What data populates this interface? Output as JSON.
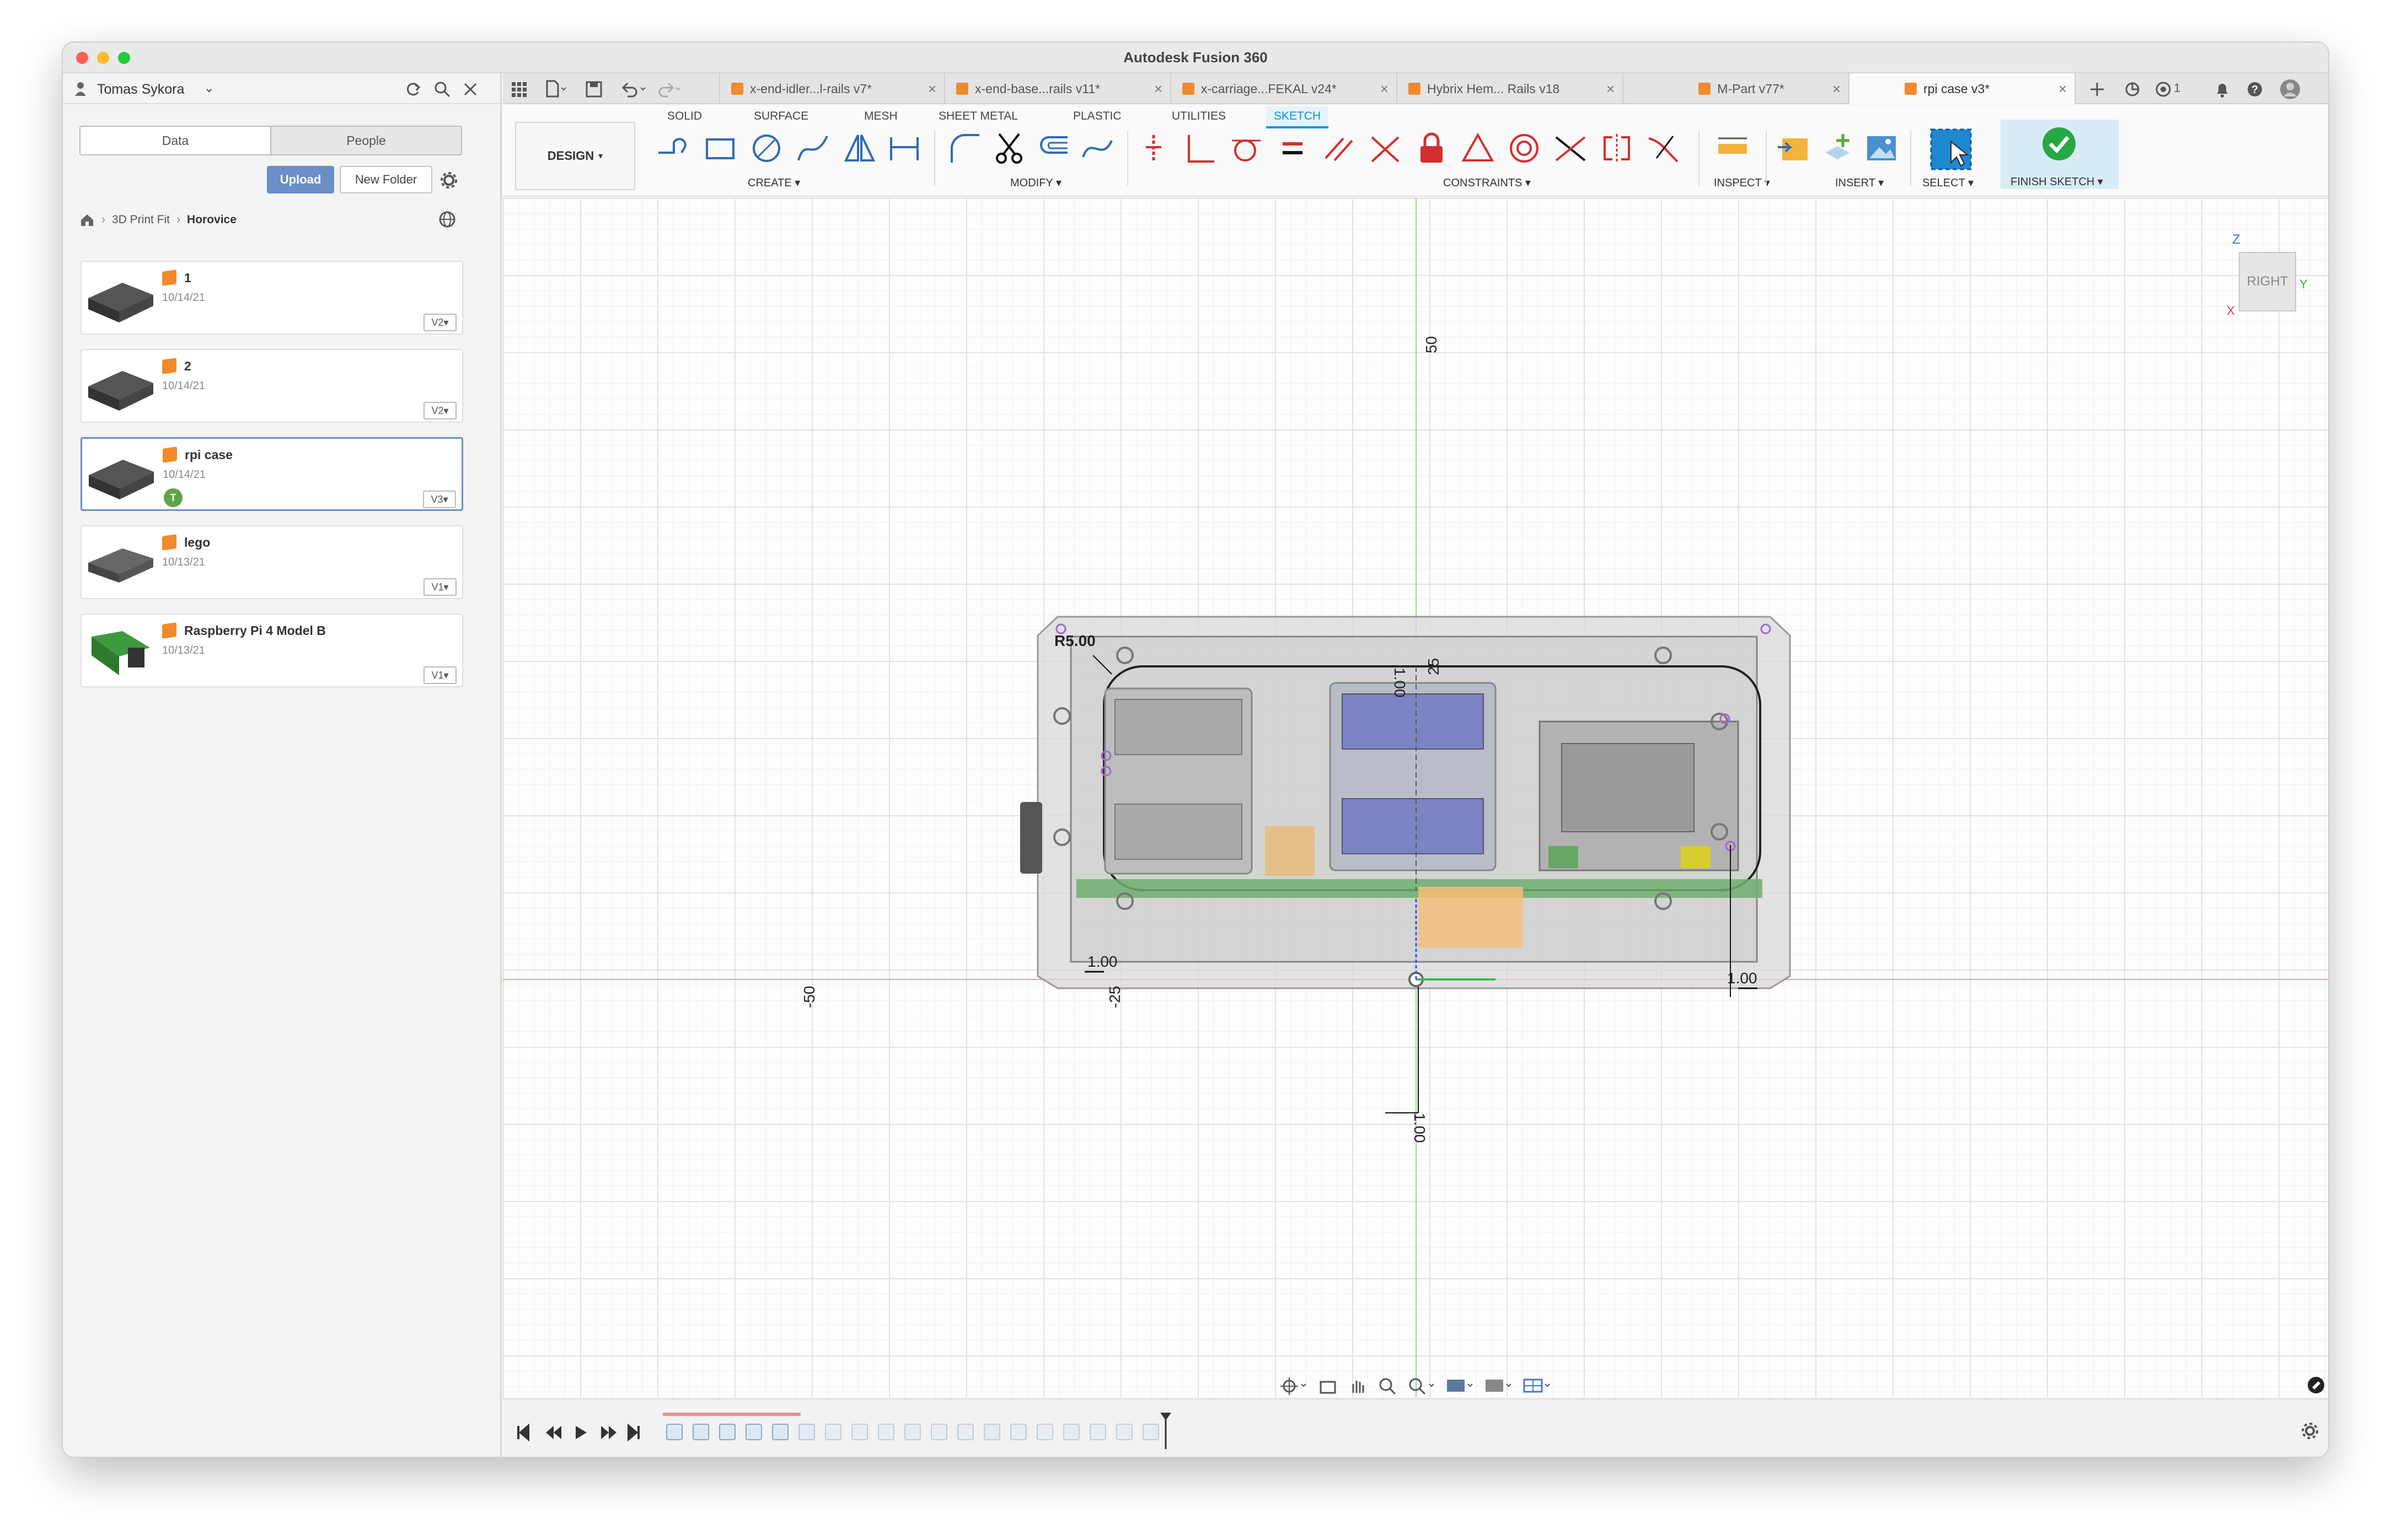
{
  "window": {
    "title": "Autodesk Fusion 360"
  },
  "data_panel": {
    "user": "Tomas Sykora",
    "user_icon": "person-icon",
    "toggle": [
      "Data",
      "People"
    ],
    "upload": "Upload",
    "new_folder": "New Folder",
    "breadcrumb": [
      "3D Print Fit",
      "Horovice"
    ],
    "items": [
      {
        "name": "1",
        "date": "10/14/21",
        "version": "V2"
      },
      {
        "name": "2",
        "date": "10/14/21",
        "version": "V2"
      },
      {
        "name": "rpi case",
        "date": "10/14/21",
        "version": "V3",
        "selected": true
      },
      {
        "name": "lego",
        "date": "10/13/21",
        "version": "V1"
      },
      {
        "name": "Raspberry Pi 4 Model B",
        "date": "10/13/21",
        "version": "V1"
      }
    ]
  },
  "tabs": [
    {
      "label": "x-end-idler...l-rails v7*",
      "active": false
    },
    {
      "label": "x-end-base...rails v11*",
      "active": false
    },
    {
      "label": "x-carriage...FEKAL v24*",
      "active": false
    },
    {
      "label": "Hybrix Hem... Rails v18",
      "active": false
    },
    {
      "label": "M-Part v77*",
      "active": false
    },
    {
      "label": "rpi case v3*",
      "active": true
    }
  ],
  "tabbar_right": {
    "jobs_count": "1"
  },
  "ribbon": {
    "workspace": "DESIGN",
    "tabs": [
      "SOLID",
      "SURFACE",
      "MESH",
      "SHEET METAL",
      "PLASTIC",
      "UTILITIES",
      "SKETCH"
    ],
    "active_tab": "SKETCH",
    "groups": [
      "CREATE",
      "MODIFY",
      "CONSTRAINTS",
      "INSPECT",
      "INSERT",
      "SELECT",
      "FINISH SKETCH"
    ]
  },
  "viewcube": {
    "face": "RIGHT",
    "axes": [
      "Z",
      "Y",
      "X"
    ]
  },
  "dimensions": {
    "top_axis": "50",
    "left_axis": "-50",
    "mid_left": "-25",
    "inner_top": "25",
    "radius": "R5.00",
    "d1": "1.00",
    "d2": "1.00",
    "d3": "1.00",
    "d4": "1.00"
  },
  "colors": {
    "accent": "#0696d7",
    "finish": "#27a844",
    "constraint": "#d32f2f"
  }
}
